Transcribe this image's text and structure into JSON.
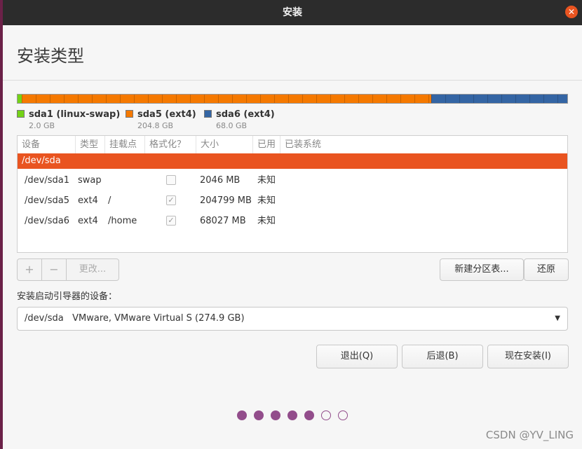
{
  "window": {
    "title": "安装"
  },
  "page": {
    "title": "安装类型"
  },
  "partition_bar": {
    "segments": [
      {
        "name": "sda1",
        "color": "#73d216",
        "fraction": 0.0073
      },
      {
        "name": "sda5",
        "color": "#f57900",
        "fraction": 0.745
      },
      {
        "name": "sda6",
        "color": "#3465a4",
        "fraction": 0.2477
      }
    ]
  },
  "legend": [
    {
      "label": "sda1 (linux-swap)",
      "size": "2.0 GB",
      "color": "#73d216"
    },
    {
      "label": "sda5 (ext4)",
      "size": "204.8 GB",
      "color": "#f57900"
    },
    {
      "label": "sda6 (ext4)",
      "size": "68.0 GB",
      "color": "#3465a4"
    }
  ],
  "table": {
    "headers": [
      "设备",
      "类型",
      "挂载点",
      "格式化？",
      "大小",
      "已用",
      "已装系统"
    ],
    "disk": "/dev/sda",
    "rows": [
      {
        "device": "/dev/sda1",
        "type": "swap",
        "mount": "",
        "format": false,
        "size": "2046 MB",
        "used": "未知",
        "os": ""
      },
      {
        "device": "/dev/sda5",
        "type": "ext4",
        "mount": "/",
        "format": true,
        "size": "204799 MB",
        "used": "未知",
        "os": ""
      },
      {
        "device": "/dev/sda6",
        "type": "ext4",
        "mount": "/home",
        "format": true,
        "size": "68027 MB",
        "used": "未知",
        "os": ""
      }
    ]
  },
  "partition_buttons": {
    "add": "+",
    "remove": "−",
    "change": "更改..."
  },
  "table_buttons": {
    "new_table": "新建分区表...",
    "revert": "还原"
  },
  "boot": {
    "label": "安装启动引导器的设备：",
    "device": "/dev/sda",
    "description": "VMware, VMware Virtual S (274.9 GB)"
  },
  "actions": {
    "quit": "退出(Q)",
    "back": "后退(B)",
    "install": "现在安装(I)"
  },
  "progress": {
    "current_step": 5,
    "total_steps": 7
  },
  "watermark": "CSDN @YV_LING"
}
